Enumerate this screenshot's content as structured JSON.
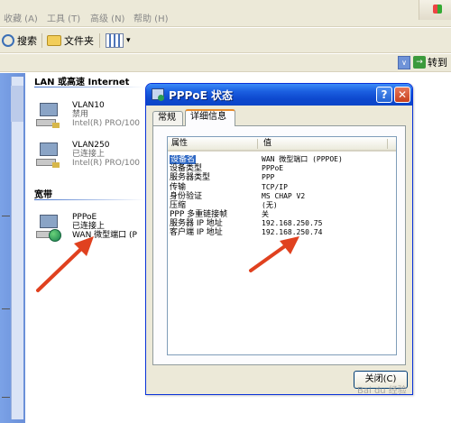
{
  "menubar": {
    "items": [
      "收藏 (A)",
      "工具 (T)",
      "高级 (N)",
      "帮助 (H)"
    ]
  },
  "toolbar": {
    "search_label": "搜索",
    "folders_label": "文件夹",
    "views_arrow": "▾"
  },
  "addressbar": {
    "dropdown_glyph": "∨",
    "go_label": "转到",
    "go_glyph": "→"
  },
  "explorer": {
    "lan_header": "LAN 或高速 Internet",
    "broadband_header": "宽带",
    "connections": [
      {
        "name": "VLAN10",
        "status": "禁用",
        "device": "Intel(R) PRO/100"
      },
      {
        "name": "VLAN250",
        "status": "已连接上",
        "device": "Intel(R) PRO/100"
      },
      {
        "name": "PPPoE",
        "status": "已连接上",
        "device": "WAN 微型端口 (P"
      }
    ]
  },
  "dialog": {
    "title": "PPPoE 状态",
    "help_glyph": "?",
    "close_glyph": "✕",
    "tabs": [
      "常规",
      "详细信息"
    ],
    "active_tab": 1,
    "columns": [
      "属性",
      "值"
    ],
    "rows": [
      {
        "property": "设备名",
        "value": "WAN 微型端口 (PPPOE)"
      },
      {
        "property": "设备类型",
        "value": "PPPoE"
      },
      {
        "property": "服务器类型",
        "value": "PPP"
      },
      {
        "property": "传输",
        "value": "TCP/IP"
      },
      {
        "property": "身份验证",
        "value": "MS CHAP V2"
      },
      {
        "property": "压缩",
        "value": "(无)"
      },
      {
        "property": "PPP 多重链接帧",
        "value": "关"
      },
      {
        "property": "服务器 IP 地址",
        "value": "192.168.250.75"
      },
      {
        "property": "客户端 IP 地址",
        "value": "192.168.250.74"
      }
    ],
    "selected_row": 0,
    "close_button_label": "关闭(C)"
  },
  "annotations": {
    "arrow_color": "#e0411f"
  },
  "watermark": "Bai du 经验"
}
